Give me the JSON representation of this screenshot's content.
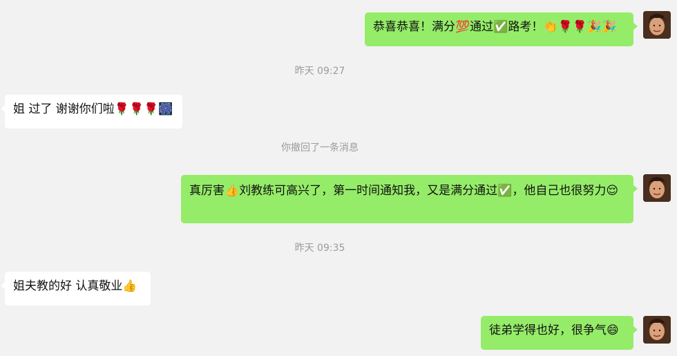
{
  "messages": [
    {
      "sender": "me",
      "text": "恭喜恭喜！满分💯通过✅路考！👏🌹🌹🎉🎉"
    },
    {
      "system": "昨天 09:27"
    },
    {
      "sender": "other",
      "text": "姐 过了 谢谢你们啦🌹🌹🌹🎆"
    },
    {
      "system": "你撤回了一条消息"
    },
    {
      "sender": "me",
      "text": "真厉害👍刘教练可高兴了，第一时间通知我，又是满分通过✅，他自己也很努力😌"
    },
    {
      "system": "昨天 09:35"
    },
    {
      "sender": "other",
      "text": "姐夫教的好 认真敬业👍"
    },
    {
      "sender": "me",
      "text": "徒弟学得也好，很争气😄"
    }
  ],
  "colors": {
    "background": "#f2f2f2",
    "my_bubble": "#95ec69",
    "other_bubble": "#ffffff",
    "system_text": "#9b9b9b"
  },
  "icons": {
    "avatar": "user-avatar-photo"
  }
}
